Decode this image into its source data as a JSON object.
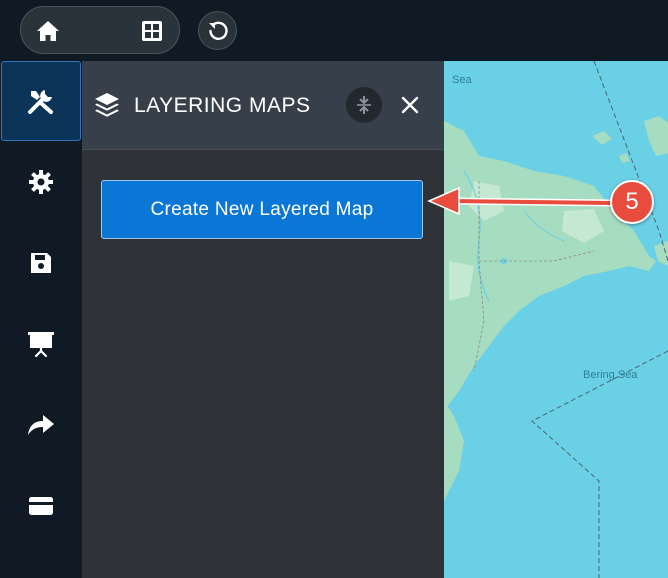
{
  "toolbar": {
    "views": [
      {
        "icon": "home-icon"
      },
      {
        "icon": "map-icon"
      },
      {
        "icon": "table-grid-icon"
      }
    ],
    "reset_icon": "rotate-left-icon",
    "active_view_color": "#0e74d2"
  },
  "sidebar": {
    "items": [
      {
        "icon": "tools-icon",
        "active": true
      },
      {
        "icon": "gear-icon"
      },
      {
        "icon": "save-icon"
      },
      {
        "icon": "presentation-icon"
      },
      {
        "icon": "share-icon"
      },
      {
        "icon": "card-icon"
      }
    ]
  },
  "panel": {
    "icon": "layers-icon",
    "title": "LAYERING MAPS",
    "collapse_icon": "collapse-vertical-icon",
    "close_icon": "close-icon",
    "create_button_label": "Create New Layered Map",
    "button_color": "#0a76d6"
  },
  "map": {
    "labels": {
      "sea_top": "Sea",
      "bering_sea": "Bering Sea"
    },
    "water_color": "#6ad0e6",
    "land_color": "#a6dcc0"
  },
  "annotation": {
    "step_number": "5",
    "color": "#e74c3c"
  }
}
